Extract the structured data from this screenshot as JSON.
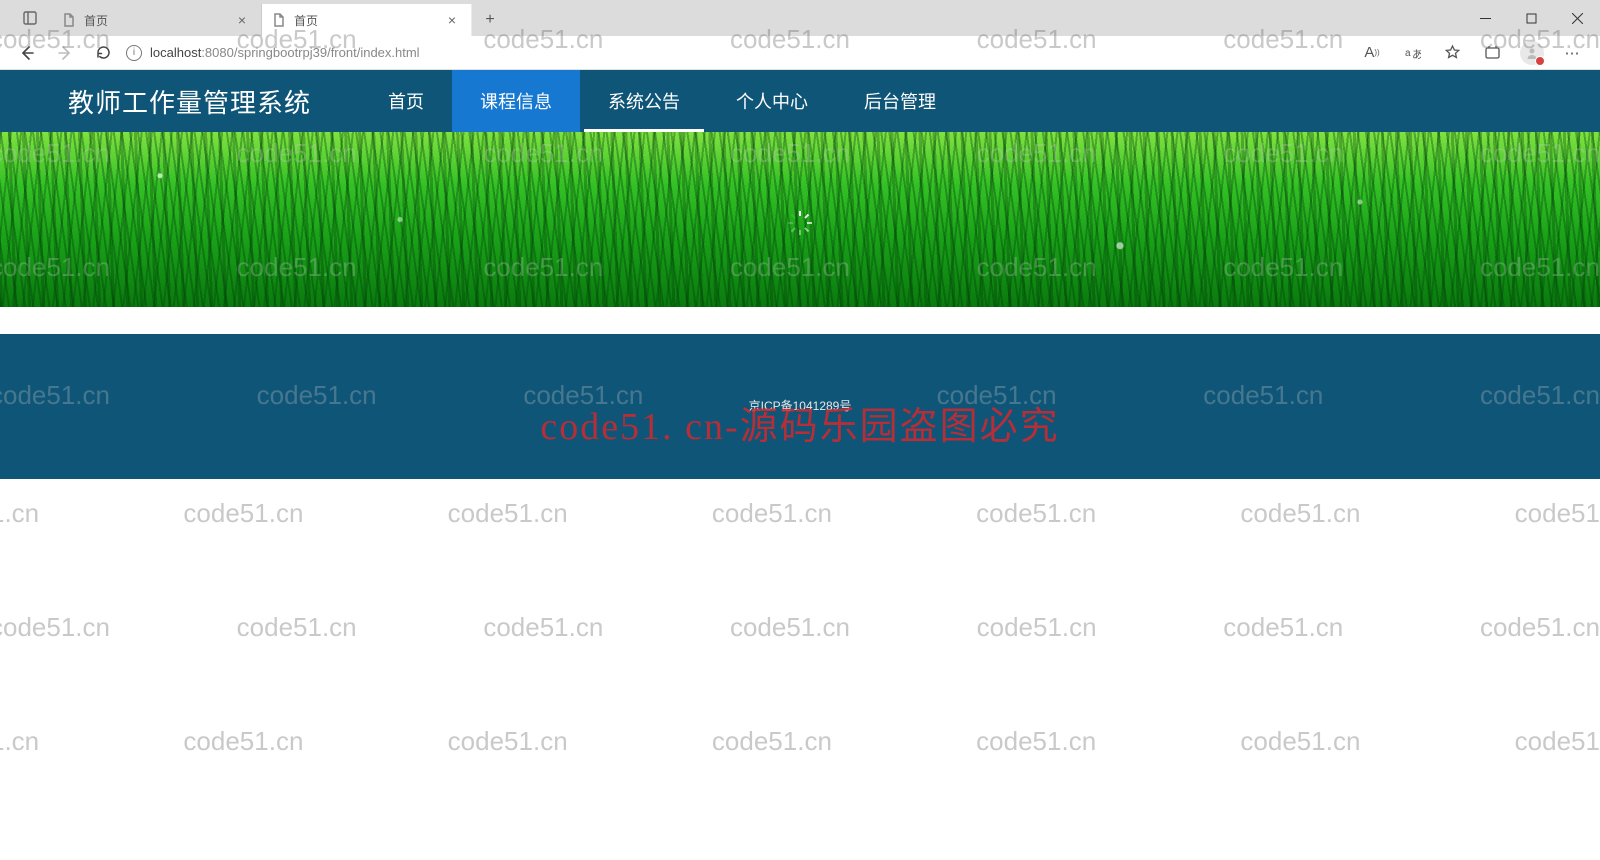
{
  "browser": {
    "tabs": [
      {
        "title": "首页",
        "active": false
      },
      {
        "title": "首页",
        "active": true
      }
    ],
    "url_host": "localhost",
    "url_port": ":8080",
    "url_path": "/springbootrpj39/front/index.html"
  },
  "nav": {
    "logo": "教师工作量管理系统",
    "items": [
      {
        "label": "首页"
      },
      {
        "label": "课程信息"
      },
      {
        "label": "系统公告"
      },
      {
        "label": "个人中心"
      },
      {
        "label": "后台管理"
      }
    ]
  },
  "footer": {
    "icp": "京ICP备1041289号"
  },
  "watermark": {
    "text": "code51.cn",
    "big": "code51. cn-源码乐园盗图必究"
  },
  "colors": {
    "nav_bg": "#0f5577",
    "nav_item_highlight": "#1678d1"
  }
}
